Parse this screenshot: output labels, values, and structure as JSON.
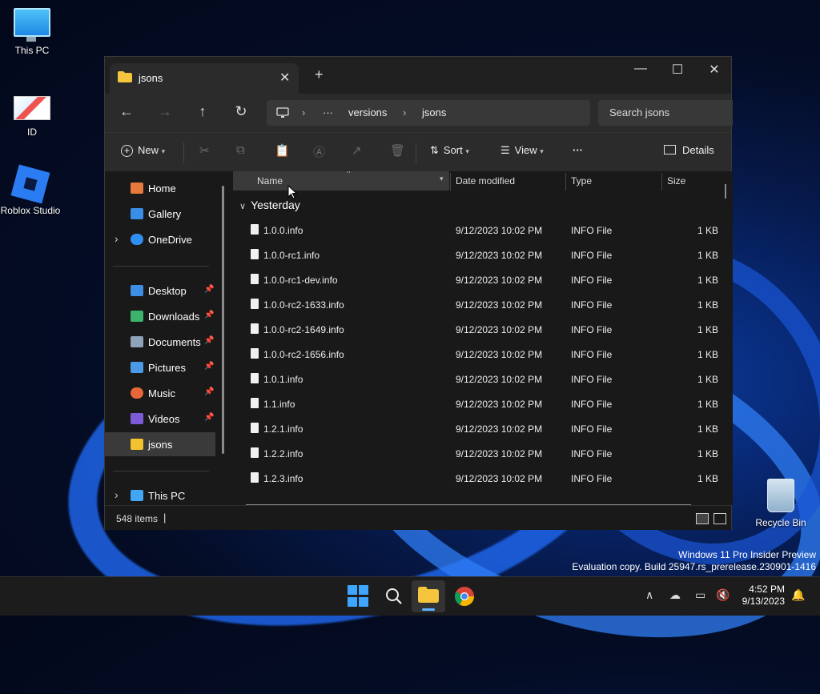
{
  "desktop": {
    "icons": [
      {
        "label": "This PC"
      },
      {
        "label": "ID"
      },
      {
        "label": "Roblox Studio"
      },
      {
        "label": "Recycle Bin"
      }
    ],
    "watermark_line1": "Windows 11 Pro Insider Preview",
    "watermark_line2": "Evaluation copy. Build 25947.rs_prerelease.230901-1416"
  },
  "window": {
    "tab_title": "jsons",
    "new_tab": "+",
    "minimize": "—",
    "maximize": "☐",
    "close": "✕"
  },
  "nav": {
    "back": "←",
    "forward": "→",
    "up": "↑",
    "refresh": "↻",
    "breadcrumb": [
      "versions",
      "jsons"
    ],
    "more": "···",
    "search_placeholder": "Search jsons"
  },
  "toolbar": {
    "new_label": "New",
    "sort_label": "Sort",
    "view_label": "View",
    "more": "···",
    "details_label": "Details"
  },
  "sidebar": {
    "items": [
      {
        "label": "Home",
        "color": "#e57a3c"
      },
      {
        "label": "Gallery",
        "color": "#3a8ee6"
      },
      {
        "label": "OneDrive",
        "color": "#2f8ff0"
      },
      {
        "label": "Desktop",
        "color": "#3f8ee6"
      },
      {
        "label": "Downloads",
        "color": "#3bb36b"
      },
      {
        "label": "Documents",
        "color": "#8ea2b8"
      },
      {
        "label": "Pictures",
        "color": "#4a9ae8"
      },
      {
        "label": "Music",
        "color": "#e8673a"
      },
      {
        "label": "Videos",
        "color": "#7b5cd6"
      },
      {
        "label": "jsons",
        "color": "#f2c230"
      },
      {
        "label": "This PC",
        "color": "#42a5f5"
      }
    ]
  },
  "columns": {
    "name": "Name",
    "date": "Date modified",
    "type": "Type",
    "size": "Size"
  },
  "group_label": "Yesterday",
  "files": [
    {
      "name": "1.0.0.info",
      "date": "9/12/2023 10:02 PM",
      "type": "INFO File",
      "size": "1 KB"
    },
    {
      "name": "1.0.0-rc1.info",
      "date": "9/12/2023 10:02 PM",
      "type": "INFO File",
      "size": "1 KB"
    },
    {
      "name": "1.0.0-rc1-dev.info",
      "date": "9/12/2023 10:02 PM",
      "type": "INFO File",
      "size": "1 KB"
    },
    {
      "name": "1.0.0-rc2-1633.info",
      "date": "9/12/2023 10:02 PM",
      "type": "INFO File",
      "size": "1 KB"
    },
    {
      "name": "1.0.0-rc2-1649.info",
      "date": "9/12/2023 10:02 PM",
      "type": "INFO File",
      "size": "1 KB"
    },
    {
      "name": "1.0.0-rc2-1656.info",
      "date": "9/12/2023 10:02 PM",
      "type": "INFO File",
      "size": "1 KB"
    },
    {
      "name": "1.0.1.info",
      "date": "9/12/2023 10:02 PM",
      "type": "INFO File",
      "size": "1 KB"
    },
    {
      "name": "1.1.info",
      "date": "9/12/2023 10:02 PM",
      "type": "INFO File",
      "size": "1 KB"
    },
    {
      "name": "1.2.1.info",
      "date": "9/12/2023 10:02 PM",
      "type": "INFO File",
      "size": "1 KB"
    },
    {
      "name": "1.2.2.info",
      "date": "9/12/2023 10:02 PM",
      "type": "INFO File",
      "size": "1 KB"
    },
    {
      "name": "1.2.3.info",
      "date": "9/12/2023 10:02 PM",
      "type": "INFO File",
      "size": "1 KB"
    }
  ],
  "status": {
    "item_count": "548 items"
  },
  "taskbar": {
    "time": "4:52 PM",
    "date": "9/13/2023"
  }
}
